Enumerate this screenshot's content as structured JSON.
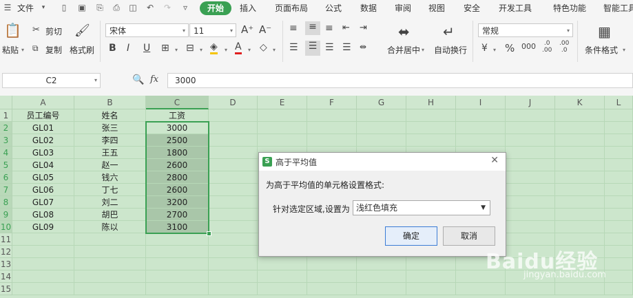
{
  "menubar": {
    "file": "文件",
    "tabs": [
      "开始",
      "插入",
      "页面布局",
      "公式",
      "数据",
      "审阅",
      "视图",
      "安全",
      "开发工具",
      "特色功能",
      "智能工具"
    ]
  },
  "ribbon": {
    "paste": "粘贴",
    "cut": "剪切",
    "copy": "复制",
    "format_painter": "格式刷",
    "font_name": "宋体",
    "font_size": "11",
    "merge_center": "合并居中",
    "auto_wrap": "自动换行",
    "number_format": "常规",
    "percent": "%",
    "cond_format": "条件格式"
  },
  "formula_bar": {
    "name_box": "C2",
    "fx": "fx",
    "value": "3000"
  },
  "sheet": {
    "columns": [
      "A",
      "B",
      "C",
      "D",
      "E",
      "F",
      "G",
      "H",
      "I",
      "J",
      "K",
      "L"
    ],
    "rows": [
      "1",
      "2",
      "3",
      "4",
      "5",
      "6",
      "7",
      "8",
      "9",
      "10",
      "11",
      "12",
      "13",
      "14",
      "15"
    ],
    "headers": [
      "员工编号",
      "姓名",
      "工资"
    ],
    "data": [
      [
        "GL01",
        "张三",
        "3000"
      ],
      [
        "GL02",
        "李四",
        "2500"
      ],
      [
        "GL03",
        "王五",
        "1800"
      ],
      [
        "GL04",
        "赵一",
        "2600"
      ],
      [
        "GL05",
        "钱六",
        "2800"
      ],
      [
        "GL06",
        "丁七",
        "2600"
      ],
      [
        "GL07",
        "刘二",
        "3200"
      ],
      [
        "GL08",
        "胡巴",
        "2700"
      ],
      [
        "GL09",
        "陈以",
        "3100"
      ]
    ]
  },
  "dialog": {
    "title": "高于平均值",
    "description": "为高于平均值的单元格设置格式:",
    "label": "针对选定区域,设置为",
    "selected": "浅红色填充",
    "ok": "确定",
    "cancel": "取消"
  },
  "watermark": {
    "brand": "Baidu经验",
    "url": "jingyan.baidu.com"
  },
  "colors": {
    "accent": "#3aa053",
    "sheet_bg": "#cce6cc",
    "selection": "#a9c6a9"
  }
}
